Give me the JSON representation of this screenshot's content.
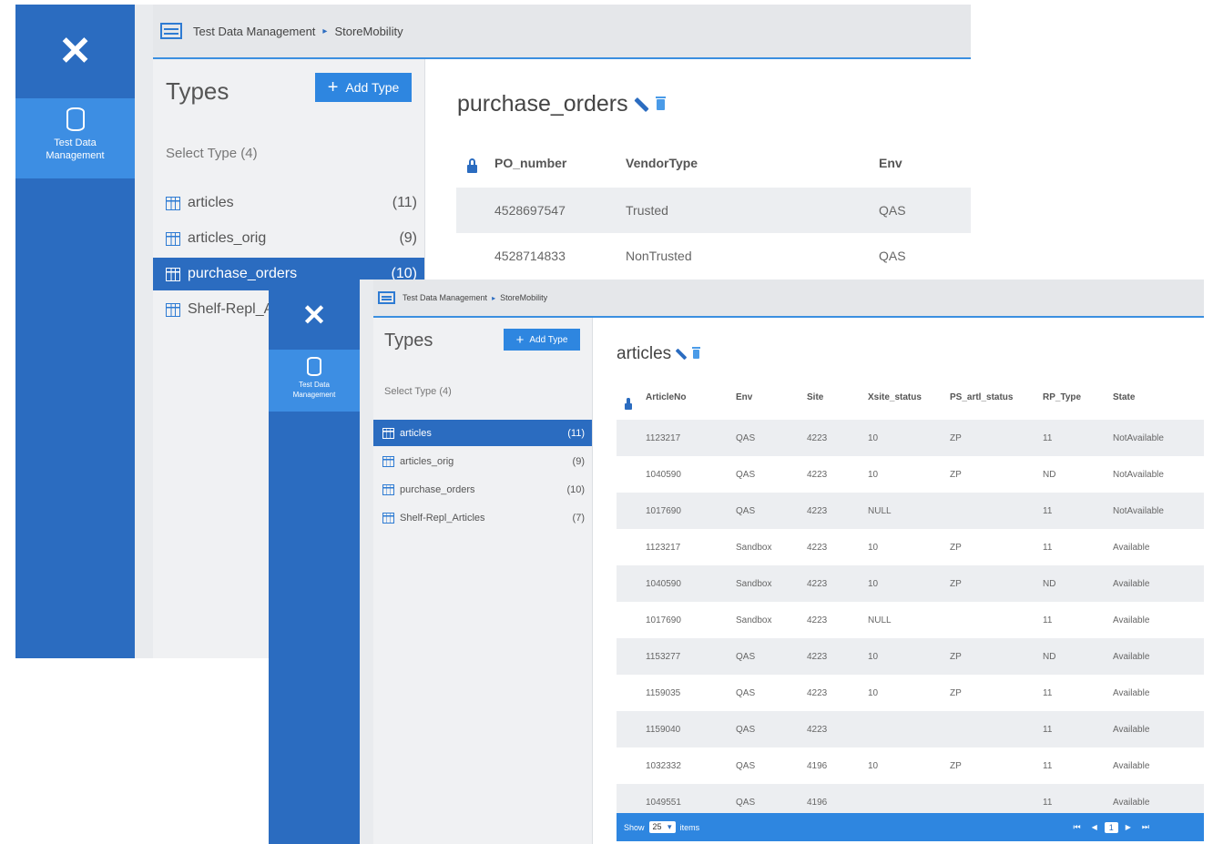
{
  "window1": {
    "breadcrumb": {
      "root": "Test Data Management",
      "sep": "▸",
      "current": "StoreMobility"
    },
    "sidebar": {
      "nav_label": "Test Data Management"
    },
    "types_panel": {
      "heading": "Types",
      "add_button": "Add Type",
      "select_label": "Select Type (4)",
      "items": [
        {
          "name": "articles",
          "count": "(11)"
        },
        {
          "name": "articles_orig",
          "count": "(9)"
        },
        {
          "name": "purchase_orders",
          "count": "(10)"
        },
        {
          "name": "Shelf-Repl_A",
          "count": ""
        }
      ]
    },
    "main": {
      "title": "purchase_orders",
      "columns": [
        "PO_number",
        "VendorType",
        "Env"
      ],
      "rows": [
        [
          "4528697547",
          "Trusted",
          "QAS"
        ],
        [
          "4528714833",
          "NonTrusted",
          "QAS"
        ]
      ]
    }
  },
  "window2": {
    "breadcrumb": {
      "root": "Test Data Management",
      "sep": "▸",
      "current": "StoreMobility"
    },
    "sidebar": {
      "nav_label": "Test Data Management"
    },
    "types_panel": {
      "heading": "Types",
      "add_button": "Add Type",
      "select_label": "Select Type (4)",
      "items": [
        {
          "name": "articles",
          "count": "(11)"
        },
        {
          "name": "articles_orig",
          "count": "(9)"
        },
        {
          "name": "purchase_orders",
          "count": "(10)"
        },
        {
          "name": "Shelf-Repl_Articles",
          "count": "(7)"
        }
      ]
    },
    "main": {
      "title": "articles",
      "columns": [
        "ArticleNo",
        "Env",
        "Site",
        "Xsite_status",
        "PS_artl_status",
        "RP_Type",
        "State"
      ],
      "rows": [
        [
          "1123217",
          "QAS",
          "4223",
          "10",
          "ZP",
          "11",
          "NotAvailable"
        ],
        [
          "1040590",
          "QAS",
          "4223",
          "10",
          "ZP",
          "ND",
          "NotAvailable"
        ],
        [
          "1017690",
          "QAS",
          "4223",
          "NULL",
          "",
          "11",
          "NotAvailable"
        ],
        [
          "1123217",
          "Sandbox",
          "4223",
          "10",
          "ZP",
          "11",
          "Available"
        ],
        [
          "1040590",
          "Sandbox",
          "4223",
          "10",
          "ZP",
          "ND",
          "Available"
        ],
        [
          "1017690",
          "Sandbox",
          "4223",
          "NULL",
          "",
          "11",
          "Available"
        ],
        [
          "1153277",
          "QAS",
          "4223",
          "10",
          "ZP",
          "ND",
          "Available"
        ],
        [
          "1159035",
          "QAS",
          "4223",
          "10",
          "ZP",
          "11",
          "Available"
        ],
        [
          "1159040",
          "QAS",
          "4223",
          "",
          "",
          "11",
          "Available"
        ],
        [
          "1032332",
          "QAS",
          "4196",
          "10",
          "ZP",
          "11",
          "Available"
        ],
        [
          "1049551",
          "QAS",
          "4196",
          "",
          "",
          "11",
          "Available"
        ]
      ],
      "pager": {
        "show_label": "Show",
        "page_size": "25",
        "items_label": "items",
        "first": "⏮",
        "prev": "◀",
        "current_page": "1",
        "next": "▶",
        "last": "⏭"
      }
    }
  },
  "colors": {
    "brand": "#2b6cc0",
    "accent": "#2e86e0",
    "nav_active": "#3d8ee3"
  }
}
